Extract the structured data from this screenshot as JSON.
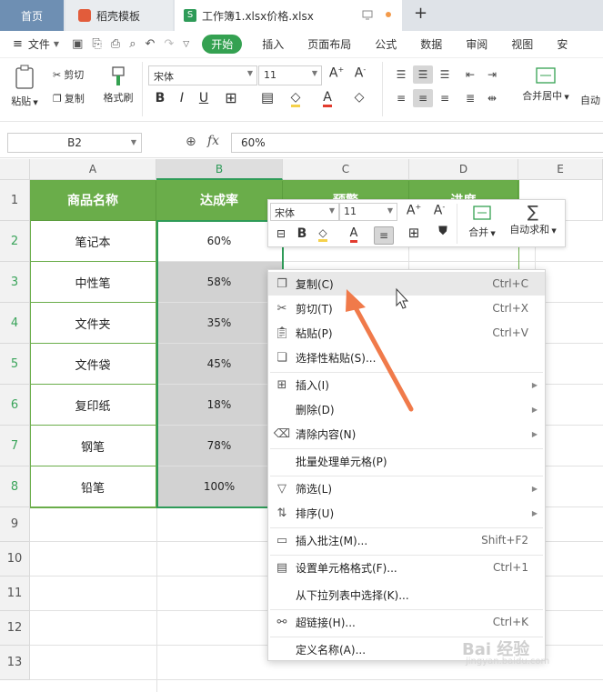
{
  "tabs": {
    "home": "首页",
    "template": "稻壳模板",
    "doc": "工作簿1.xlsx价格.xlsx",
    "doc_icon": "S",
    "new_tab": "+"
  },
  "menubar": {
    "file": "文件",
    "items": [
      "开始",
      "插入",
      "页面布局",
      "公式",
      "数据",
      "审阅",
      "视图",
      "安"
    ]
  },
  "ribbon": {
    "paste": "粘贴",
    "cut": "剪切",
    "copy": "复制",
    "format_painter": "格式刷",
    "font_name": "宋体",
    "font_size": "11",
    "merge_center": "合并居中",
    "auto_label": "自动"
  },
  "formula_bar": {
    "cell_ref": "B2",
    "fx": "fx",
    "value": "60%"
  },
  "columns": [
    "A",
    "B",
    "C",
    "D",
    "E"
  ],
  "rows": [
    "1",
    "2",
    "3",
    "4",
    "5",
    "6",
    "7",
    "8",
    "9",
    "10",
    "11",
    "12",
    "13"
  ],
  "table": {
    "header": [
      "商品名称",
      "达成率",
      "预警",
      "进度"
    ],
    "names": [
      "笔记本",
      "中性笔",
      "文件夹",
      "文件袋",
      "复印纸",
      "钢笔",
      "铅笔"
    ],
    "rates": [
      "60%",
      "58%",
      "35%",
      "45%",
      "18%",
      "78%",
      "100%"
    ]
  },
  "mini_toolbar": {
    "font": "宋体",
    "size": "11",
    "merge": "合并",
    "autosum": "自动求和"
  },
  "context_menu": [
    {
      "label": "复制(C)",
      "shortcut": "Ctrl+C"
    },
    {
      "label": "剪切(T)",
      "shortcut": "Ctrl+X"
    },
    {
      "label": "粘贴(P)",
      "shortcut": "Ctrl+V"
    },
    {
      "label": "选择性粘贴(S)...",
      "shortcut": ""
    },
    {
      "label": "插入(I)",
      "shortcut": ""
    },
    {
      "label": "删除(D)",
      "shortcut": ""
    },
    {
      "label": "清除内容(N)",
      "shortcut": ""
    },
    {
      "label": "批量处理单元格(P)",
      "shortcut": ""
    },
    {
      "label": "筛选(L)",
      "shortcut": ""
    },
    {
      "label": "排序(U)",
      "shortcut": ""
    },
    {
      "label": "插入批注(M)...",
      "shortcut": "Shift+F2"
    },
    {
      "label": "设置单元格格式(F)...",
      "shortcut": "Ctrl+1"
    },
    {
      "label": "从下拉列表中选择(K)...",
      "shortcut": ""
    },
    {
      "label": "超链接(H)...",
      "shortcut": "Ctrl+K"
    },
    {
      "label": "定义名称(A)...",
      "shortcut": ""
    }
  ],
  "watermark": {
    "main": "Bai 经验",
    "sub": "jingyan.baidu.com"
  },
  "colors": {
    "accent": "#2e9b58",
    "header_fill": "#6aad4a",
    "arrow": "#f07a4a"
  }
}
